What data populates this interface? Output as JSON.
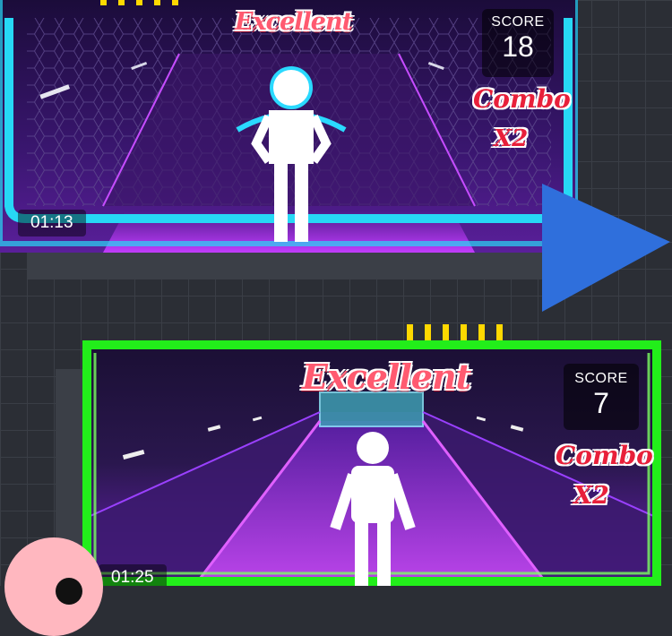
{
  "panel_top": {
    "feedback": "Excellent",
    "score_label": "SCORE",
    "score_value": "18",
    "combo_label": "Combo",
    "combo_multiplier": "X2",
    "timer": "01:13",
    "frame_color": "#27d8f5"
  },
  "panel_bottom": {
    "feedback": "Excellent",
    "score_label": "SCORE",
    "score_value": "7",
    "combo_label": "Combo",
    "combo_multiplier": "X2",
    "timer": "01:25",
    "frame_color": "#22ee1a"
  },
  "colors": {
    "accent_arrow": "#2f6fdc",
    "tick_marks": "#ffd800",
    "combo_text": "#e8203a",
    "track_glow": "#b528ff"
  },
  "icons": [
    "next-arrow-icon",
    "player-figure-icon"
  ]
}
